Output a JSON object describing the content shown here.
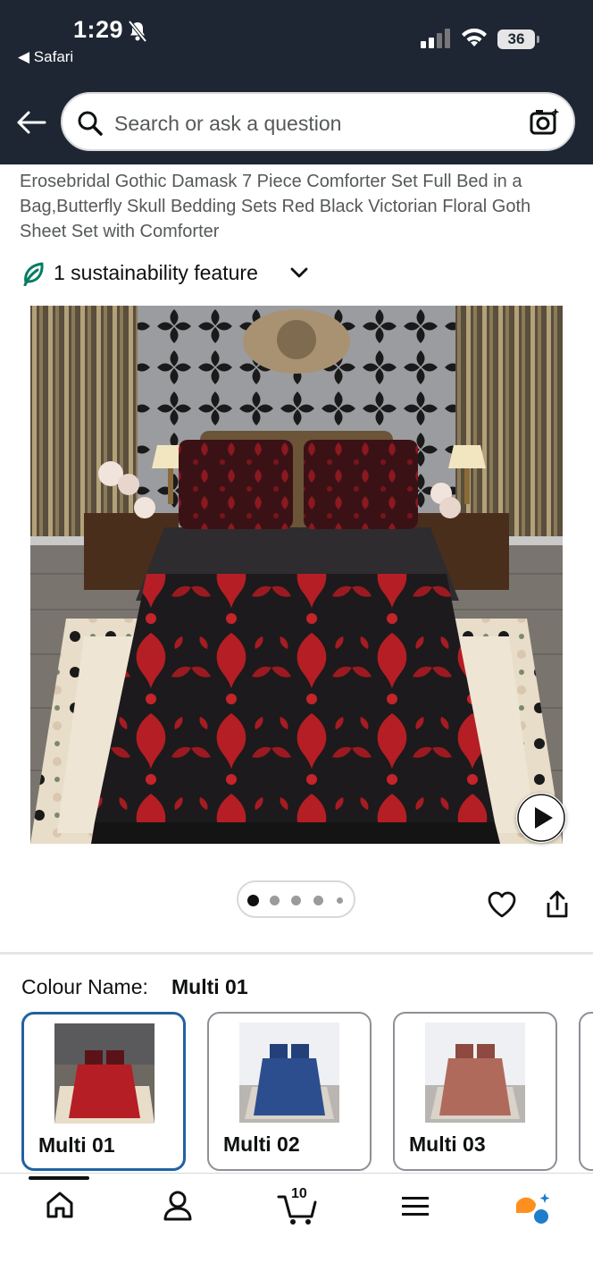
{
  "status_bar": {
    "time": "1:29",
    "back_app": "Safari",
    "battery": "36"
  },
  "search": {
    "placeholder": "Search or ask a question"
  },
  "product": {
    "title": "Erosebridal Gothic Damask 7 Piece Comforter Set Full Bed in a Bag,Butterfly Skull Bedding Sets Red Black Victorian Floral Goth Sheet Set with Comforter",
    "sustainability": "1 sustainability feature",
    "image_count": 5,
    "current_image": 1
  },
  "colour": {
    "label": "Colour Name:",
    "selected": "Multi 01",
    "options": [
      {
        "label": "Multi 01",
        "accent": "#b51e24",
        "selected": true
      },
      {
        "label": "Multi 02",
        "accent": "#2c4e8f",
        "selected": false
      },
      {
        "label": "Multi 03",
        "accent": "#b06a5c",
        "selected": false
      }
    ]
  },
  "bottom_nav": {
    "items": [
      "home",
      "account",
      "cart",
      "menu",
      "rufus"
    ],
    "cart_count": "10"
  },
  "colors": {
    "header_bg": "#1e2633",
    "accent_blue": "#2162a1",
    "sustain_green": "#067d62",
    "rufus_orange": "#ff8f1c",
    "rufus_blue": "#1f7dcc"
  }
}
